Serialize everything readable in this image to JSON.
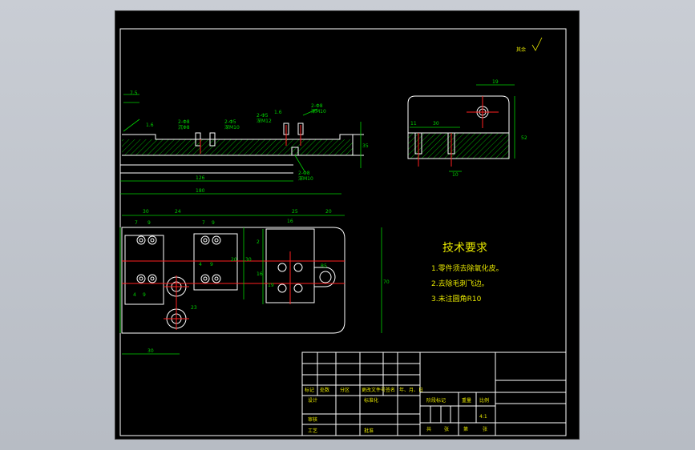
{
  "roughness": "其余",
  "notes": {
    "title": "技术要求",
    "items": [
      "1.零件须去除氧化皮。",
      "2.去除毛刺飞边。",
      "3.未注圆角R10"
    ]
  },
  "front_view": {
    "dims": {
      "top_small": "7.5",
      "roughness_left": "1.6",
      "total_len": "180",
      "inner_len": "126",
      "height": "35"
    },
    "callouts": [
      {
        "a": "2-Φ8",
        "b": "沉Φ8"
      },
      {
        "a": "2-Φ5",
        "b": "深M10"
      },
      {
        "a": "2-Φ5",
        "b": "深M12"
      },
      {
        "a": "1.6",
        "b": ""
      },
      {
        "a": "2-Φ8",
        "b": "深M10"
      },
      {
        "a": "2-Φ8",
        "b": "深M10"
      }
    ]
  },
  "side_view": {
    "dims": {
      "top": "19",
      "left1": "11",
      "left2": "30",
      "height": "52",
      "bottom": "10"
    }
  },
  "top_view": {
    "dims": {
      "top_a": "30",
      "top_b": "7",
      "top_c": "9",
      "top_d": "24",
      "top_e": "7",
      "top_f": "9",
      "top_g": "25",
      "top_h": "16",
      "top_i": "20",
      "mid_a": "4",
      "mid_b": "9",
      "left_a": "4",
      "left_b": "9",
      "v1": "20",
      "v2": "30",
      "v3": "2",
      "v4": "16",
      "v5": "19",
      "v6": "70",
      "v7": "23",
      "bottom_len": "30",
      "r": "R5"
    }
  },
  "title_block": {
    "row_headers": [
      "标记",
      "处数",
      "分区",
      "更改文件号",
      "签名",
      "年、月、日"
    ],
    "design_row": [
      "设计",
      "标准化"
    ],
    "review": "审核",
    "process": "工艺",
    "approve": "批准",
    "stage_headers": [
      "阶段标记",
      "重量",
      "比例"
    ],
    "scale": "4:1",
    "sheet_row": [
      "共",
      "张",
      "第",
      "张"
    ]
  }
}
